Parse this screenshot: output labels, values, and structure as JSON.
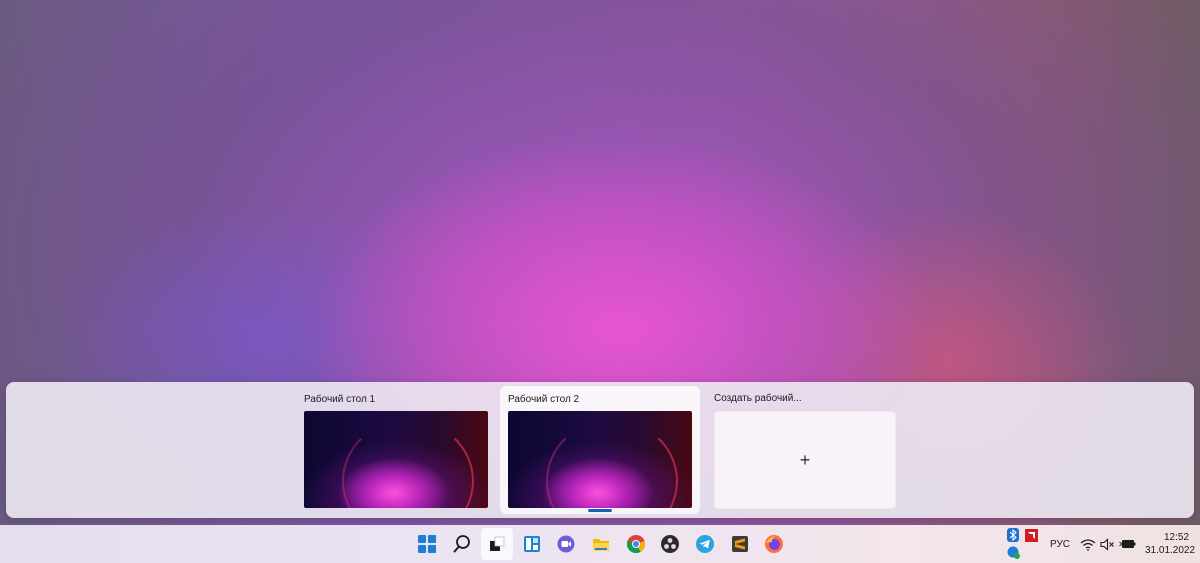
{
  "task_view": {
    "desktops": [
      {
        "label": "Рабочий стол 1",
        "active": false
      },
      {
        "label": "Рабочий стол 2",
        "active": true
      }
    ],
    "new_desktop_label": "Создать рабочий...",
    "new_desktop_plus": "+"
  },
  "taskbar": {
    "apps": [
      {
        "name": "start-icon"
      },
      {
        "name": "search-icon"
      },
      {
        "name": "task-view-icon",
        "active": true
      },
      {
        "name": "widgets-icon"
      },
      {
        "name": "teams-chat-icon"
      },
      {
        "name": "file-explorer-icon"
      },
      {
        "name": "chrome-icon"
      },
      {
        "name": "obs-icon"
      },
      {
        "name": "telegram-icon"
      },
      {
        "name": "sublime-text-icon"
      },
      {
        "name": "firefox-icon"
      }
    ],
    "tray": {
      "language": "РУС",
      "time": "12:52",
      "date": "31.01.2022"
    }
  },
  "colors": {
    "accent": "#1e7fd6",
    "active_indicator": "#1a5fb4"
  }
}
